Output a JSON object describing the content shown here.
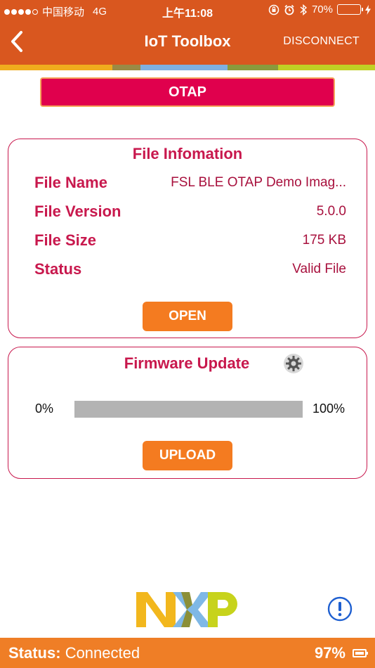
{
  "status_bar": {
    "carrier": "中国移动",
    "network": "4G",
    "time": "上午11:08",
    "battery_percent": "70%",
    "battery_level": 0.7,
    "signal_bars_filled": 4,
    "signal_bars_total": 5
  },
  "nav": {
    "title": "IoT Toolbox",
    "back_icon": "chevron-left-icon",
    "disconnect_label": "DISCONNECT"
  },
  "color_strip": [
    "#f0ac1d",
    "#9a8a45",
    "#7fb0e0",
    "#8a9a3c",
    "#c0d024"
  ],
  "otap_label": "OTAP",
  "file_info": {
    "title": "File Infomation",
    "rows": [
      {
        "label": "File Name",
        "value": "FSL BLE OTAP Demo Imag..."
      },
      {
        "label": "File Version",
        "value": "5.0.0"
      },
      {
        "label": "File Size",
        "value": "175 KB"
      },
      {
        "label": "Status",
        "value": "Valid File"
      }
    ],
    "open_label": "OPEN"
  },
  "firmware": {
    "title": "Firmware Update",
    "gear_icon": "gear-icon",
    "min_label": "0%",
    "max_label": "100%",
    "progress": 0,
    "upload_label": "UPLOAD"
  },
  "footer": {
    "logo": "nxp-logo",
    "info_icon": "info-icon",
    "status_label": "Status:",
    "status_value": "Connected",
    "battery_percent": "97%"
  },
  "colors": {
    "brand_orange": "#d9571f",
    "accent_red": "#c8184d",
    "otap_red": "#e0004d",
    "button_orange": "#f47b20",
    "bottom_bar": "#ef7e26"
  }
}
